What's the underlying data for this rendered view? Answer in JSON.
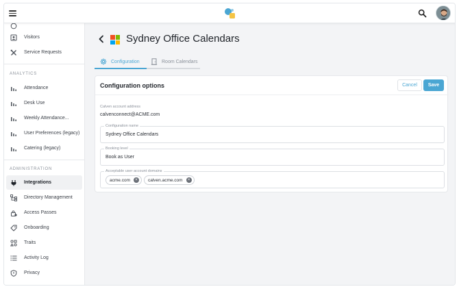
{
  "sidebar": {
    "items_top": [
      {
        "label": "Visitors",
        "icon": "id-badge-icon"
      },
      {
        "label": "Service Requests",
        "icon": "tools-icon"
      }
    ],
    "analytics_title": "ANALYTICS",
    "analytics_items": [
      {
        "label": "Attendance",
        "icon": "bar-chart-icon"
      },
      {
        "label": "Desk Use",
        "icon": "bar-chart-icon"
      },
      {
        "label": "Weekly Attendance...",
        "icon": "bar-chart-icon"
      },
      {
        "label": "User Preferences (legacy)",
        "icon": "bar-chart-icon"
      },
      {
        "label": "Catering (legacy)",
        "icon": "bar-chart-icon"
      }
    ],
    "admin_title": "ADMINISTRATION",
    "admin_items": [
      {
        "label": "Integrations",
        "icon": "plug-icon",
        "active": true
      },
      {
        "label": "Directory Management",
        "icon": "hierarchy-icon"
      },
      {
        "label": "Access Passes",
        "icon": "lock-icon"
      },
      {
        "label": "Onboarding",
        "icon": "tag-icon"
      },
      {
        "label": "Traits",
        "icon": "shapes-icon"
      },
      {
        "label": "Activity Log",
        "icon": "list-icon"
      },
      {
        "label": "Privacy",
        "icon": "shield-icon"
      }
    ]
  },
  "header": {
    "title": "Sydney Office Calendars"
  },
  "tabs": [
    {
      "label": "Configuration",
      "active": true
    },
    {
      "label": "Room Calendars",
      "active": false
    }
  ],
  "card": {
    "title": "Configuration options",
    "cancel_label": "Cancel",
    "save_label": "Save",
    "account_label": "Calven account address",
    "account_value": "calvenconnect@ACME.com",
    "config_name_label": "Configuration name",
    "config_name_value": "Sydney Office Calendars",
    "booking_level_label": "Booking level",
    "booking_level_value": "Book as User",
    "domains_label": "Acceptable user account domains",
    "domains": [
      "acme.com",
      "calven.acme.com"
    ]
  },
  "colors": {
    "accent": "#4aa6d3",
    "ms_red": "#f25022",
    "ms_green": "#7fba00",
    "ms_blue": "#00a4ef",
    "ms_yellow": "#ffb900"
  }
}
